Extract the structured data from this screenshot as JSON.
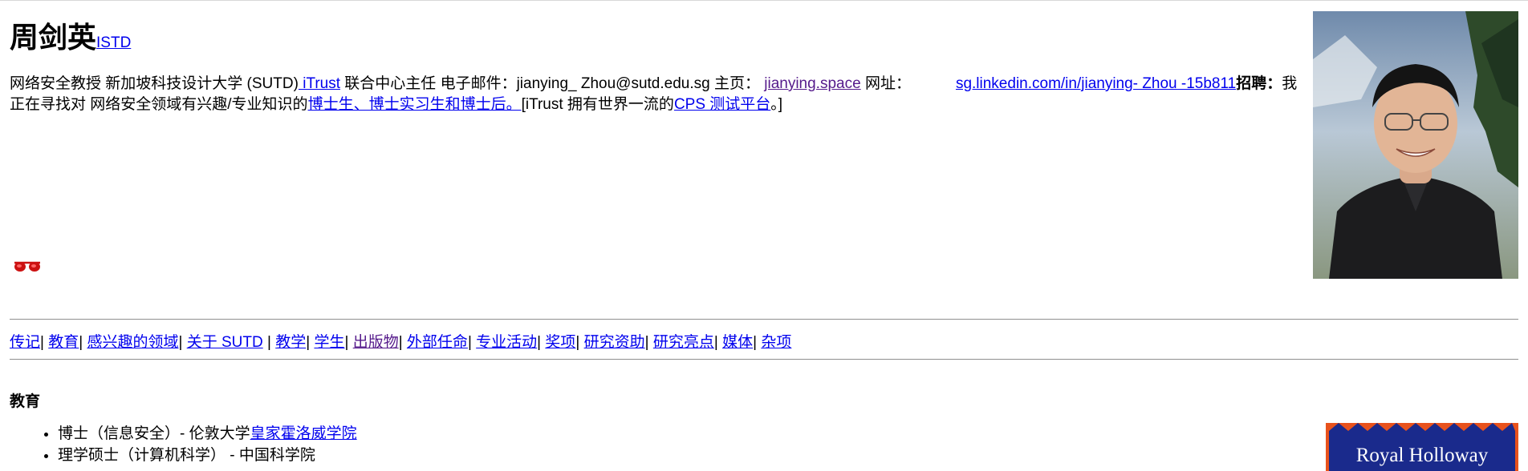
{
  "header": {
    "name": "周剑英",
    "dept_link": "ISTD"
  },
  "intro": {
    "title": "网络安全教授 新加坡科技设计大学 (SUTD)",
    "itrust_link": " iTrust",
    "role": " 联合中心主任 电子邮件：jianying_ Zhou@sutd.edu.sg 主页：",
    "homepage_link": "jianying.space",
    "web_label": " 网址：",
    "linkedin_link": "sg.linkedin.com/in/jianying- Zhou -15b811",
    "recruit_bold": "招聘：",
    "recruit_text": "我正在寻找对 网络安全领域有兴趣/专业知识的",
    "recruit_link": "博士生、博士实习生和博士后。",
    "itrust_text": "[iTrust 拥有世界一流的",
    "cps_link": "CPS 测试平台",
    "itrust_end": "。]"
  },
  "nav": {
    "items": [
      {
        "label": "传记",
        "visited": false
      },
      {
        "label": "教育",
        "visited": false
      },
      {
        "label": "感兴趣的领域",
        "visited": false
      },
      {
        "label": "关于 SUTD",
        "visited": false
      },
      {
        "label": "教学",
        "visited": false
      },
      {
        "label": "学生",
        "visited": false
      },
      {
        "label": "出版物",
        "visited": true
      },
      {
        "label": "外部任命",
        "visited": false
      },
      {
        "label": "专业活动",
        "visited": false
      },
      {
        "label": "奖项",
        "visited": false
      },
      {
        "label": "研究资助",
        "visited": false
      },
      {
        "label": "研究亮点",
        "visited": false
      },
      {
        "label": "媒体",
        "visited": false
      },
      {
        "label": "杂项",
        "visited": false
      }
    ],
    "separators": [
      "|",
      "|",
      "|",
      "|",
      "|",
      "|",
      "|",
      "|",
      "|",
      "|",
      "|",
      "|",
      "|"
    ]
  },
  "education": {
    "title": "教育",
    "items": [
      {
        "text": "博士（信息安全）- 伦敦大学",
        "link": "皇家霍洛威学院"
      },
      {
        "text": "理学硕士（计算机科学） - 中国科学院",
        "link": ""
      }
    ]
  },
  "logo": {
    "text": "Royal Holloway",
    "bg_color": "#1a2a8c",
    "accent_color": "#e8521c"
  },
  "colors": {
    "link": "#0000ee",
    "visited": "#551a8b",
    "glasses": "#cc1111"
  },
  "icons": {
    "glasses": "sunglasses-icon"
  }
}
